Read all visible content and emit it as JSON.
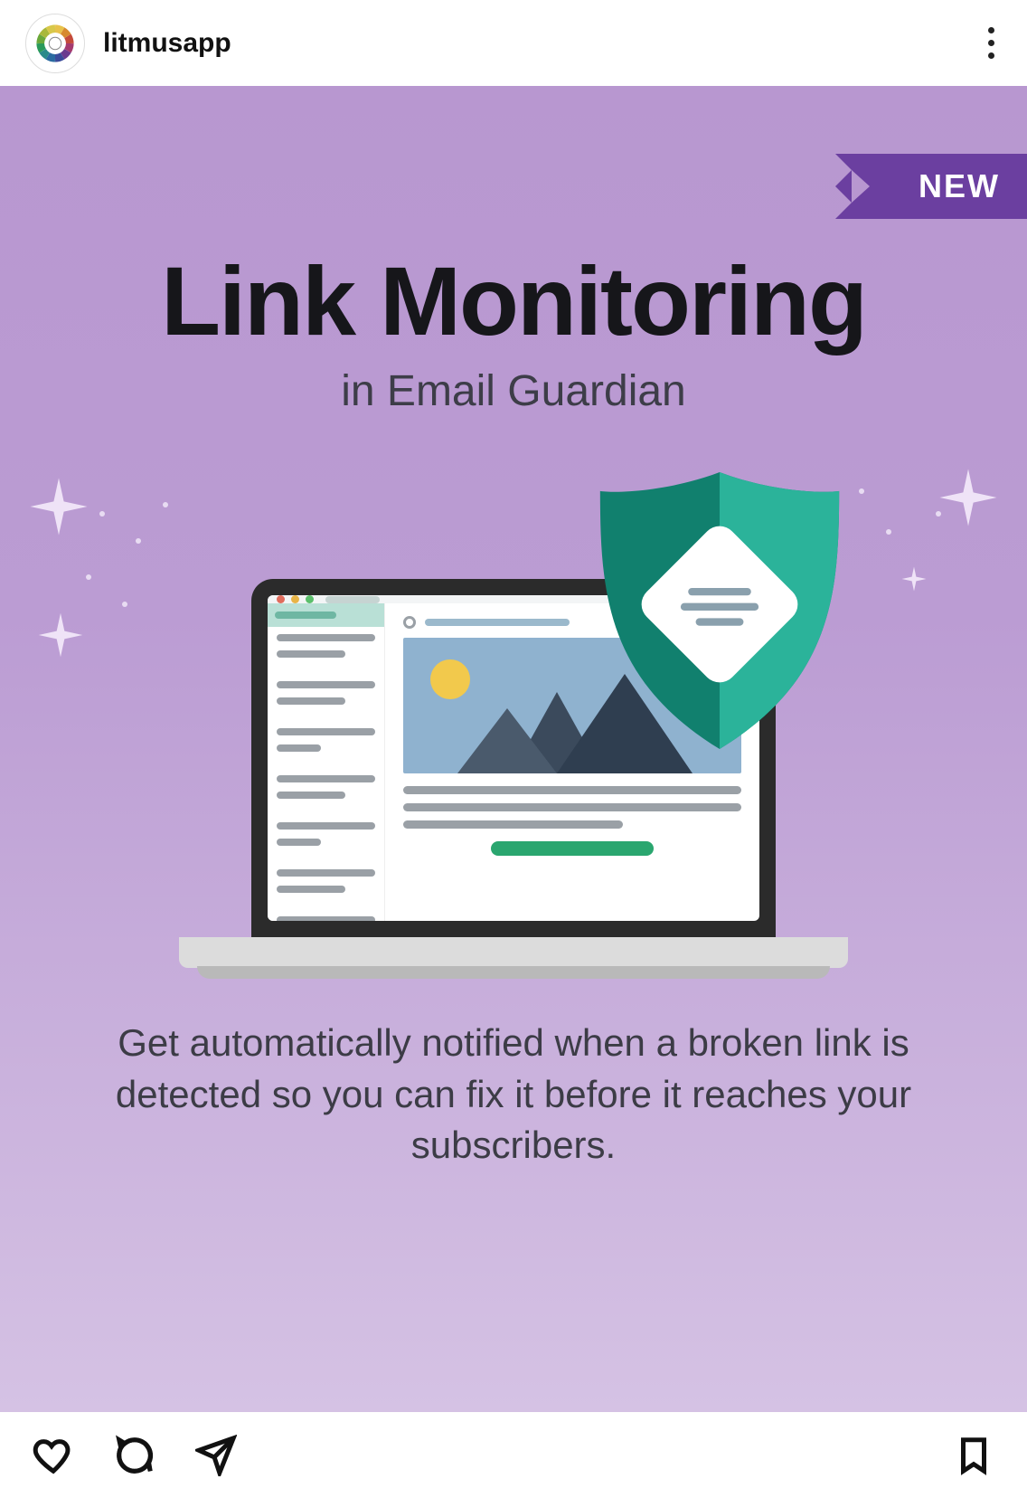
{
  "header": {
    "username": "litmusapp"
  },
  "post": {
    "ribbon_label": "NEW",
    "headline": "Link Monitoring",
    "subheadline": "in Email Guardian",
    "body_copy": "Get automatically notified when a broken link is detected so you can fix it before it reaches your subscribers."
  },
  "colors": {
    "bg_top": "#b897d0",
    "bg_bottom": "#d5c2e4",
    "ribbon": "#6b3fa0",
    "shield_dark": "#0f7a69",
    "shield_light": "#2bb39a",
    "cta_green": "#2aa66f",
    "hero_blue": "#8fb2cf",
    "sun": "#f2c94c"
  },
  "icons": {
    "avatar": "color-wheel-logo",
    "more": "more-vertical-icon",
    "like": "heart-icon",
    "comment": "comment-icon",
    "share": "paper-plane-icon",
    "save": "bookmark-icon",
    "shield": "shield-icon"
  }
}
